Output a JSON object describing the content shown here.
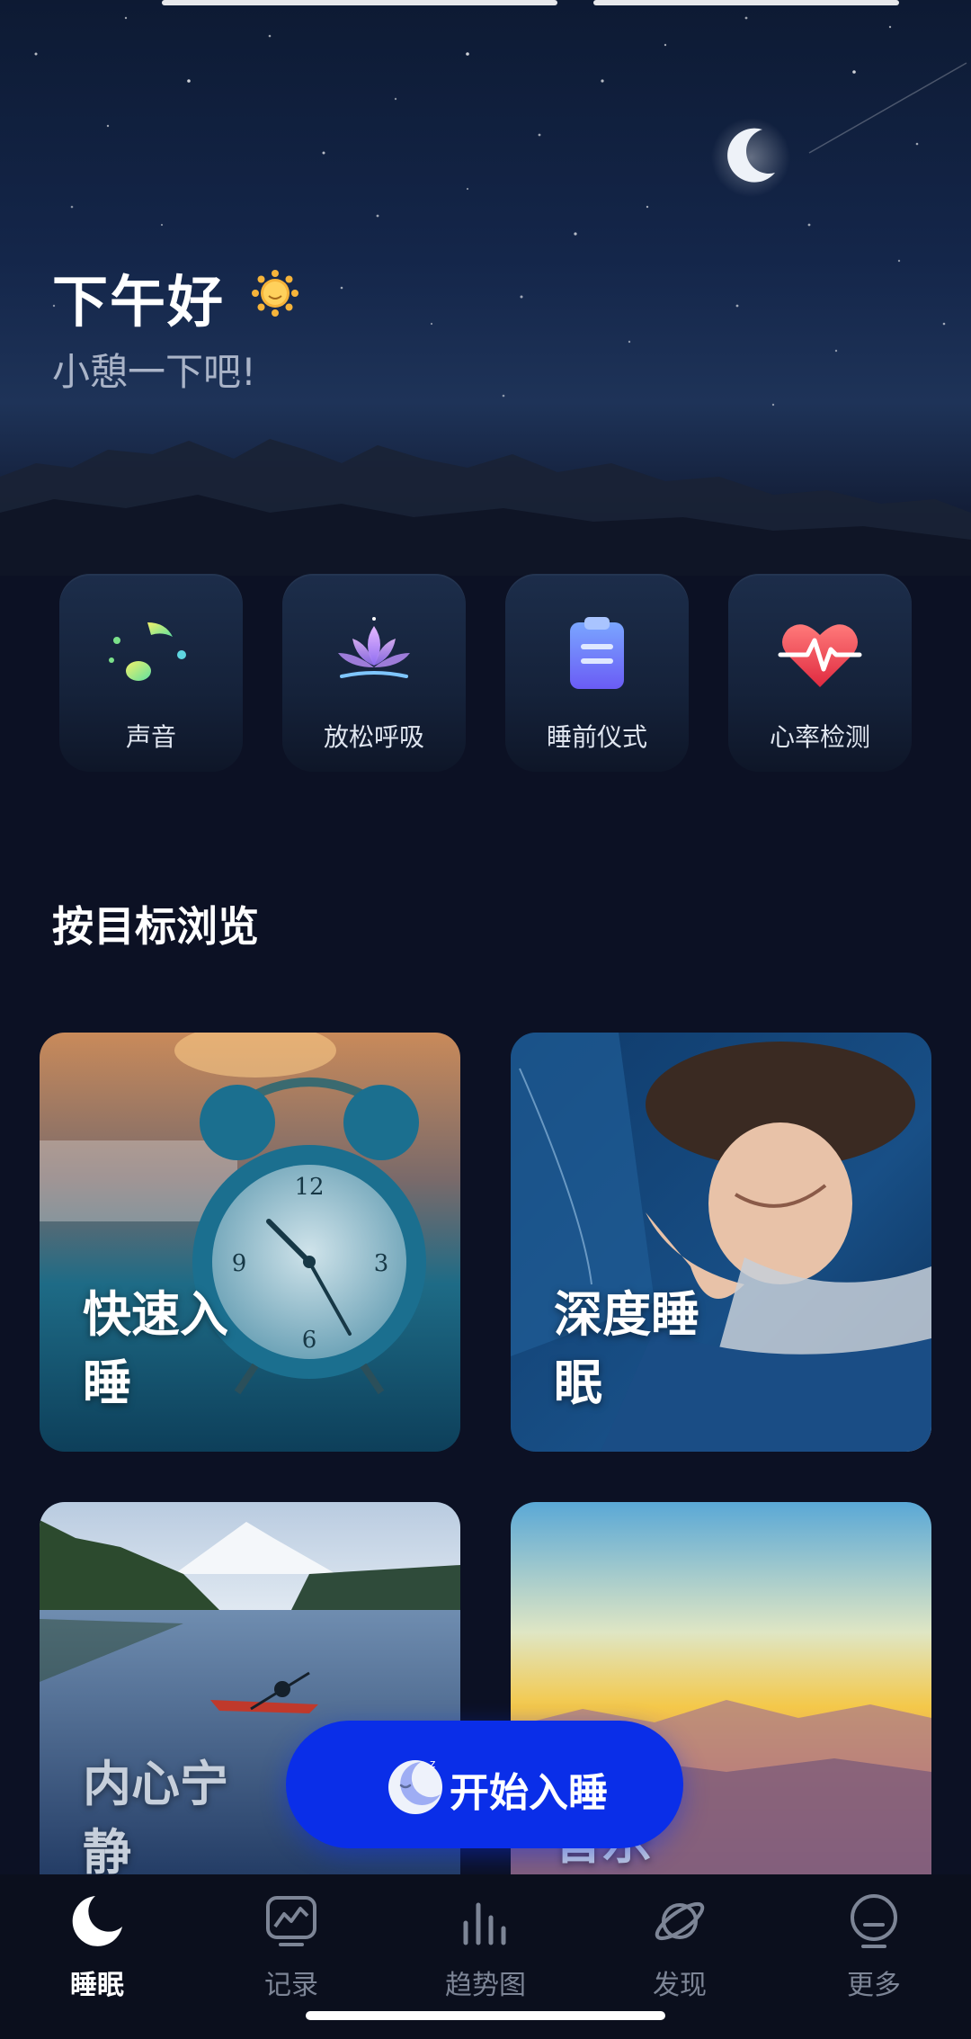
{
  "header": {
    "greeting": "下午好",
    "subtitle": "小憩一下吧!"
  },
  "quick_actions": [
    {
      "label": "声音",
      "icon": "music-note-icon"
    },
    {
      "label": "放松呼吸",
      "icon": "lotus-icon"
    },
    {
      "label": "睡前仪式",
      "icon": "clipboard-icon"
    },
    {
      "label": "心率检测",
      "icon": "heart-rate-icon"
    }
  ],
  "section": {
    "title": "按目标浏览"
  },
  "goals": [
    {
      "label": "快速入睡",
      "image": "alarm-clock"
    },
    {
      "label": "深度睡眠",
      "image": "sleeping-woman"
    },
    {
      "label": "内心宁静",
      "image": "lake-kayak"
    },
    {
      "label": "音乐",
      "image": "sunset-sky"
    }
  ],
  "start_button": {
    "label": "开始入睡"
  },
  "tabs": [
    {
      "label": "睡眠",
      "icon": "moon-icon",
      "active": true
    },
    {
      "label": "记录",
      "icon": "chart-record-icon",
      "active": false
    },
    {
      "label": "趋势图",
      "icon": "bar-trend-icon",
      "active": false
    },
    {
      "label": "发现",
      "icon": "planet-icon",
      "active": false
    },
    {
      "label": "更多",
      "icon": "more-face-icon",
      "active": false
    }
  ],
  "colors": {
    "background": "#0c1124",
    "accent": "#0a2ee8",
    "card": "#17243d",
    "tab_inactive": "#7d8596"
  }
}
